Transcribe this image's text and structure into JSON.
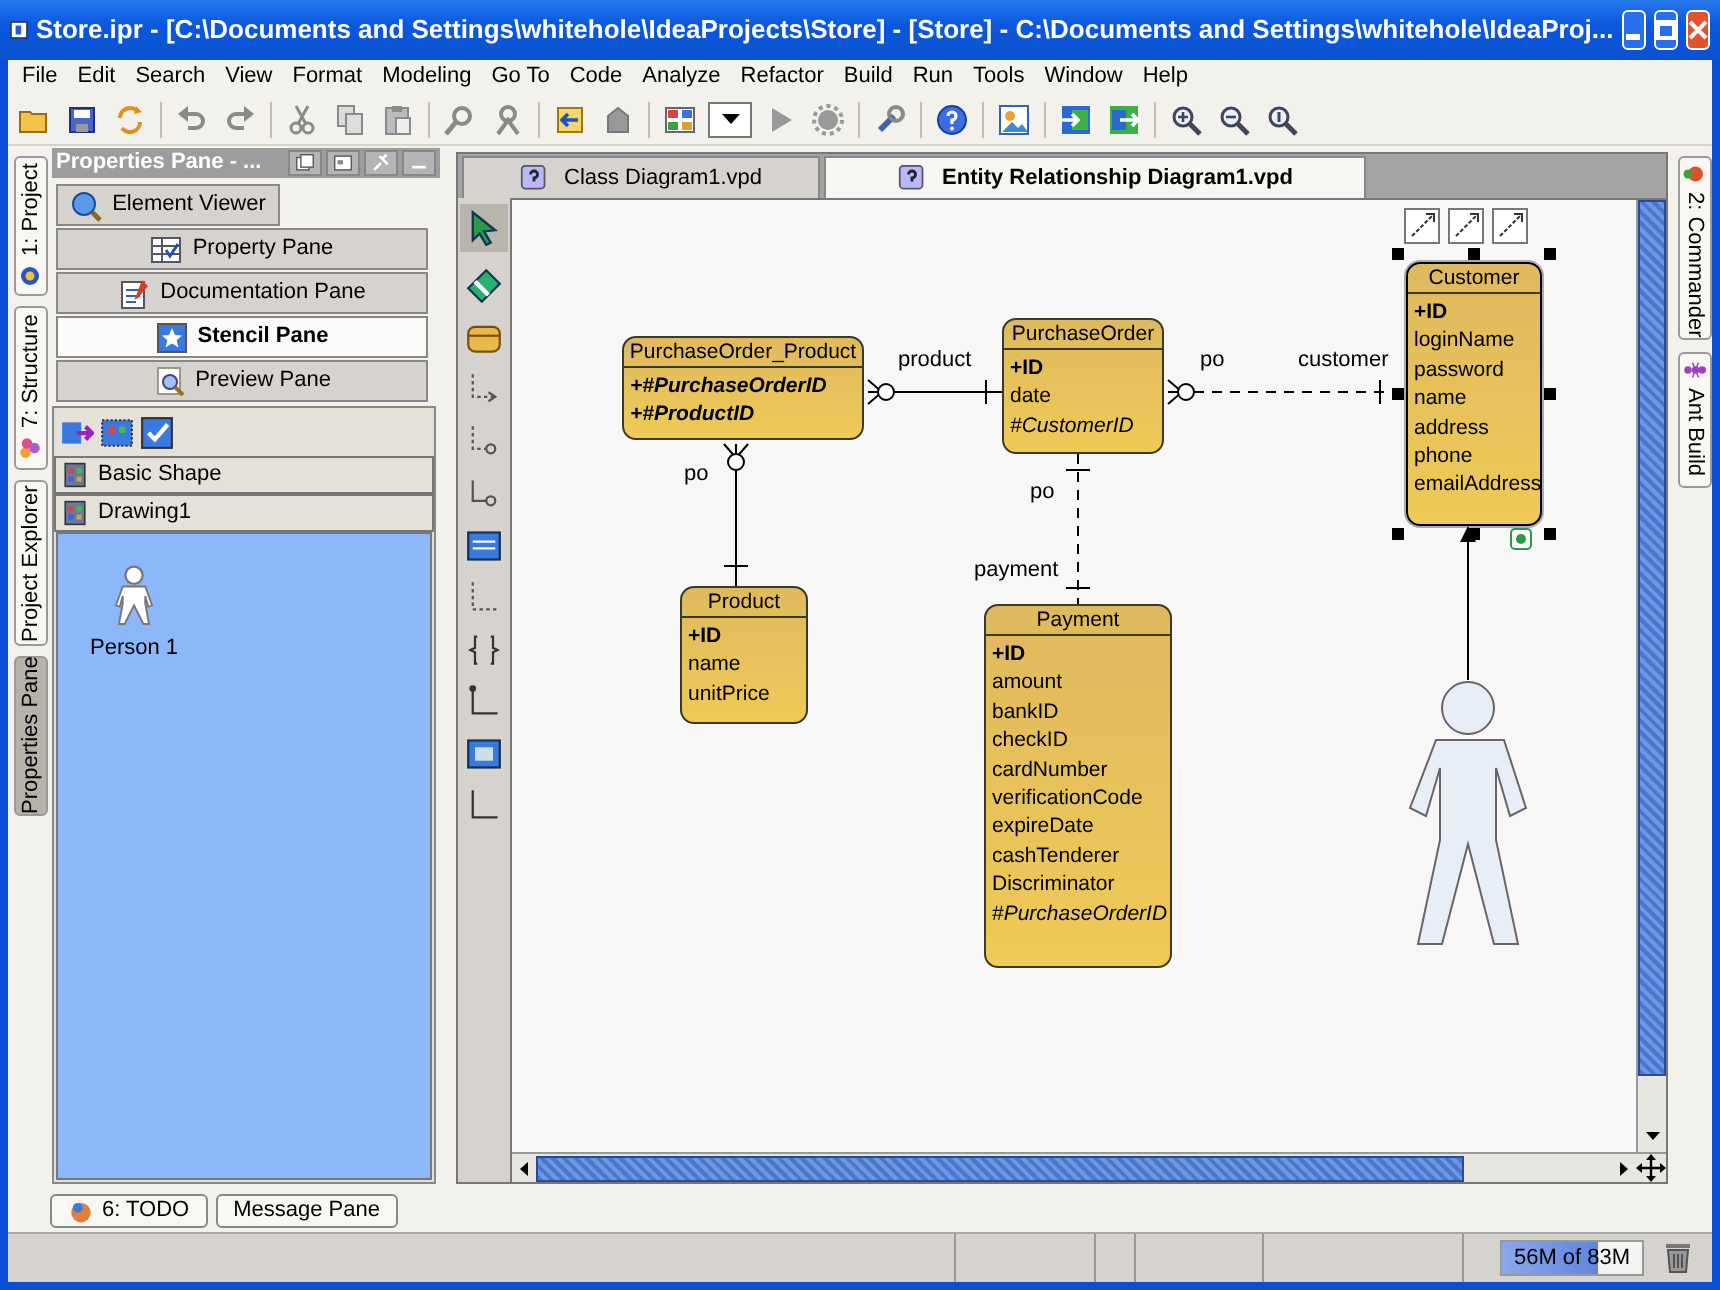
{
  "window": {
    "title": "Store.ipr - [C:\\Documents and Settings\\whitehole\\IdeaProjects\\Store] - [Store] - C:\\Documents and Settings\\whitehole\\IdeaProj..."
  },
  "menu": [
    "File",
    "Edit",
    "Search",
    "View",
    "Format",
    "Modeling",
    "Go To",
    "Code",
    "Analyze",
    "Refactor",
    "Build",
    "Run",
    "Tools",
    "Window",
    "Help"
  ],
  "left_tool_windows": [
    {
      "label": "1: Project",
      "selected": false
    },
    {
      "label": "7: Structure",
      "selected": false
    },
    {
      "label": "Project Explorer",
      "selected": false
    },
    {
      "label": "Properties Pane",
      "selected": true
    }
  ],
  "properties_pane": {
    "title": "Properties Pane - ...",
    "tabs": [
      {
        "label": "Element Viewer",
        "selected": false
      },
      {
        "label": "Property Pane",
        "selected": false
      },
      {
        "label": "Documentation Pane",
        "selected": false
      },
      {
        "label": "Stencil Pane",
        "selected": true
      },
      {
        "label": "Preview Pane",
        "selected": false
      }
    ],
    "stencil_groups": [
      "Basic Shape",
      "Drawing1"
    ],
    "shapes": [
      "Person 1"
    ]
  },
  "editor_tabs": [
    {
      "label": "Class Diagram1.vpd",
      "selected": false
    },
    {
      "label": "Entity Relationship Diagram1.vpd",
      "selected": true
    }
  ],
  "diagram": {
    "entities": [
      {
        "name": "PurchaseOrder_Product",
        "selected": false,
        "columns": [
          {
            "text": "+#PurchaseOrderID",
            "kind": "key_foreign"
          },
          {
            "text": "+#ProductID",
            "kind": "key_foreign"
          }
        ]
      },
      {
        "name": "PurchaseOrder",
        "selected": false,
        "columns": [
          {
            "text": "+ID",
            "kind": "key"
          },
          {
            "text": "date",
            "kind": "plain"
          },
          {
            "text": "#CustomerID",
            "kind": "foreign"
          }
        ]
      },
      {
        "name": "Customer",
        "selected": true,
        "columns": [
          {
            "text": "+ID",
            "kind": "key"
          },
          {
            "text": "loginName",
            "kind": "plain"
          },
          {
            "text": "password",
            "kind": "plain"
          },
          {
            "text": "name",
            "kind": "plain"
          },
          {
            "text": "address",
            "kind": "plain"
          },
          {
            "text": "phone",
            "kind": "plain"
          },
          {
            "text": "emailAddress",
            "kind": "plain"
          }
        ]
      },
      {
        "name": "Product",
        "selected": false,
        "columns": [
          {
            "text": "+ID",
            "kind": "key"
          },
          {
            "text": "name",
            "kind": "plain"
          },
          {
            "text": "unitPrice",
            "kind": "plain"
          }
        ]
      },
      {
        "name": "Payment",
        "selected": false,
        "columns": [
          {
            "text": "+ID",
            "kind": "key"
          },
          {
            "text": "amount",
            "kind": "plain"
          },
          {
            "text": "bankID",
            "kind": "plain"
          },
          {
            "text": "checkID",
            "kind": "plain"
          },
          {
            "text": "cardNumber",
            "kind": "plain"
          },
          {
            "text": "verificationCode",
            "kind": "plain"
          },
          {
            "text": "expireDate",
            "kind": "plain"
          },
          {
            "text": "cashTenderer",
            "kind": "plain"
          },
          {
            "text": "Discriminator",
            "kind": "plain"
          },
          {
            "text": "#*PurchaseOrderID*",
            "kind": "plain"
          }
        ]
      }
    ],
    "relationships": [
      {
        "kind": "solid",
        "labels": [
          "product"
        ]
      },
      {
        "kind": "dashed",
        "labels": [
          "po",
          "customer"
        ]
      },
      {
        "kind": "solid",
        "labels": [
          "po"
        ]
      },
      {
        "kind": "dashed",
        "labels": [
          "po",
          "payment"
        ]
      }
    ]
  },
  "right_tool_windows": [
    {
      "label": "2: Commander"
    },
    {
      "label": "Ant Build"
    }
  ],
  "bottom_tool_windows": [
    "6: TODO",
    "Message Pane"
  ],
  "status_bar": {
    "memory": "56M of 83M",
    "level": 0.68
  }
}
